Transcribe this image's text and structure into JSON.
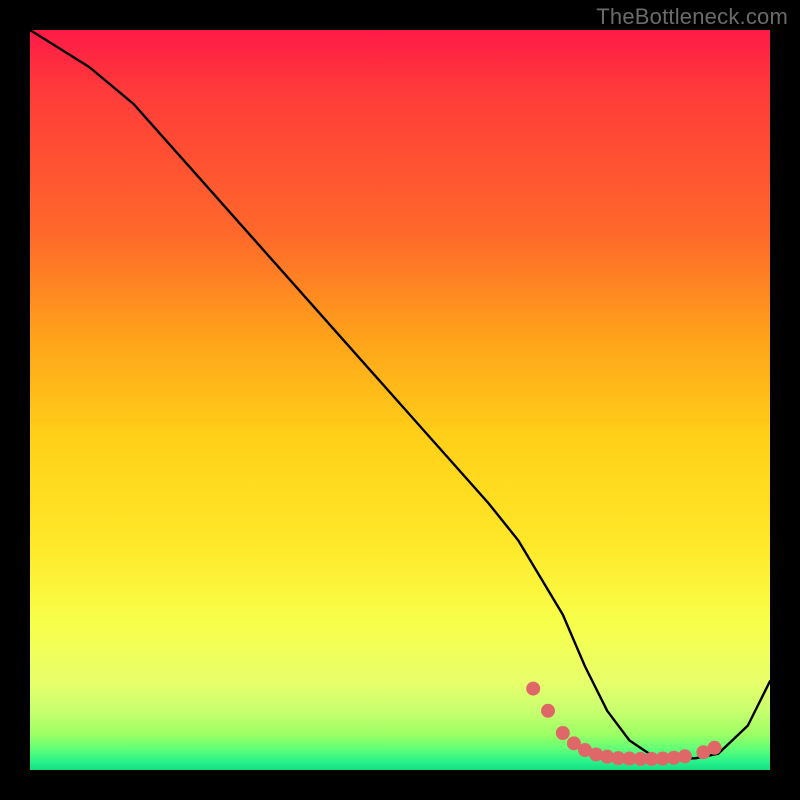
{
  "watermark": "TheBottleneck.com",
  "chart_data": {
    "type": "line",
    "title": "",
    "xlabel": "",
    "ylabel": "",
    "xlim": [
      0,
      100
    ],
    "ylim": [
      0,
      100
    ],
    "grid": false,
    "series": [
      {
        "name": "bottleneck-curve",
        "x": [
          0,
          4,
          8,
          14,
          22,
          30,
          38,
          46,
          54,
          62,
          66,
          69,
          72,
          75,
          78,
          81,
          84,
          86,
          88,
          90,
          93,
          97,
          100
        ],
        "values": [
          100,
          97.5,
          95,
          90,
          81,
          72,
          63,
          54,
          45,
          36,
          31,
          26,
          21,
          14,
          8,
          4,
          2,
          1.5,
          1.5,
          1.6,
          2.2,
          6,
          12
        ]
      }
    ],
    "highlight": {
      "name": "valley-dots",
      "points": [
        {
          "x": 68,
          "y": 11
        },
        {
          "x": 70,
          "y": 8
        },
        {
          "x": 72,
          "y": 5
        },
        {
          "x": 73.5,
          "y": 3.6
        },
        {
          "x": 75,
          "y": 2.7
        },
        {
          "x": 76.5,
          "y": 2.1
        },
        {
          "x": 78,
          "y": 1.8
        },
        {
          "x": 79.5,
          "y": 1.6
        },
        {
          "x": 81,
          "y": 1.55
        },
        {
          "x": 82.5,
          "y": 1.5
        },
        {
          "x": 84,
          "y": 1.5
        },
        {
          "x": 85.5,
          "y": 1.55
        },
        {
          "x": 87,
          "y": 1.65
        },
        {
          "x": 88.5,
          "y": 1.85
        },
        {
          "x": 91,
          "y": 2.4
        },
        {
          "x": 92.5,
          "y": 3.0
        }
      ],
      "color": "#e06767",
      "radius": 7
    },
    "colors": {
      "curve": "#000000",
      "background_top": "#ff1a47",
      "background_bottom": "#14dd82",
      "watermark": "#6b6b6b"
    }
  }
}
